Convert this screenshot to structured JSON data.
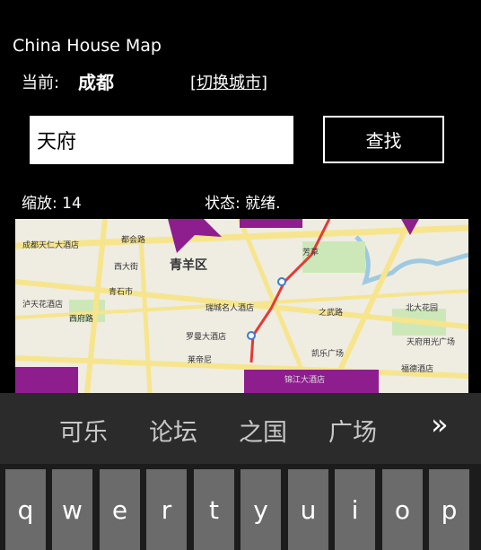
{
  "app": {
    "title": "China House Map"
  },
  "location": {
    "label": "当前:",
    "city": "成都",
    "switch_label": "[切换城市]"
  },
  "search": {
    "value": "天府",
    "button_label": "查找"
  },
  "status": {
    "zoom": "缩放: 14",
    "state": "状态: 就绪."
  },
  "map": {
    "district": "青羊区",
    "labels": [
      "成都天仁大酒店",
      "青石市",
      "泸天花酒店",
      "西府路",
      "瑞城名人酒店",
      "罗曼大酒店",
      "莱帝尼",
      "凯乐广场",
      "芳草",
      "北大花园",
      "天府用光广场",
      "福德酒店",
      "西大街",
      "都会路",
      "锦江大酒店",
      "之武路"
    ],
    "colors": {
      "background": "#efece2",
      "road": "#f6e58d",
      "route": "#e53935",
      "overlay": "#8e1e8e",
      "water": "#9ecae1",
      "green": "#cde8b8"
    }
  },
  "suggestions": [
    "可乐",
    "论坛",
    "之国",
    "广场"
  ],
  "more_icon": "double-chevron-right-icon",
  "keyboard": {
    "keys": [
      "q",
      "w",
      "e",
      "r",
      "t",
      "y",
      "u",
      "i",
      "o",
      "p"
    ]
  }
}
